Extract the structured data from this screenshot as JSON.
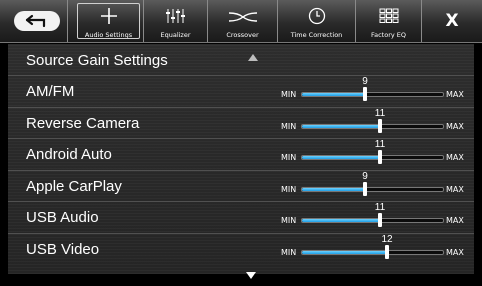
{
  "topbar": {
    "back_icon": "back-arrow-icon",
    "tabs": [
      {
        "label": "Audio Settings",
        "icon": "plus-icon",
        "active": true
      },
      {
        "label": "Equalizer",
        "icon": "equalizer-icon",
        "active": false
      },
      {
        "label": "Crossover",
        "icon": "crossover-icon",
        "active": false
      },
      {
        "label": "Time Correction",
        "icon": "clock-icon",
        "active": false
      },
      {
        "label": "Factory EQ",
        "icon": "grid-icon",
        "active": false
      }
    ],
    "close_label": "X"
  },
  "page": {
    "title": "Source Gain Settings",
    "slider_min_label": "MIN",
    "slider_max_label": "MAX"
  },
  "sources": [
    {
      "name": "AM/FM",
      "value": "9"
    },
    {
      "name": "Reverse Camera",
      "value": "11"
    },
    {
      "name": "Android Auto",
      "value": "11"
    },
    {
      "name": "Apple CarPlay",
      "value": "9"
    },
    {
      "name": "USB Audio",
      "value": "11"
    },
    {
      "name": "USB Video",
      "value": "12"
    }
  ],
  "colors": {
    "slider_fill": "#1e9ee6",
    "panel_bg": "#2a2a2a"
  }
}
